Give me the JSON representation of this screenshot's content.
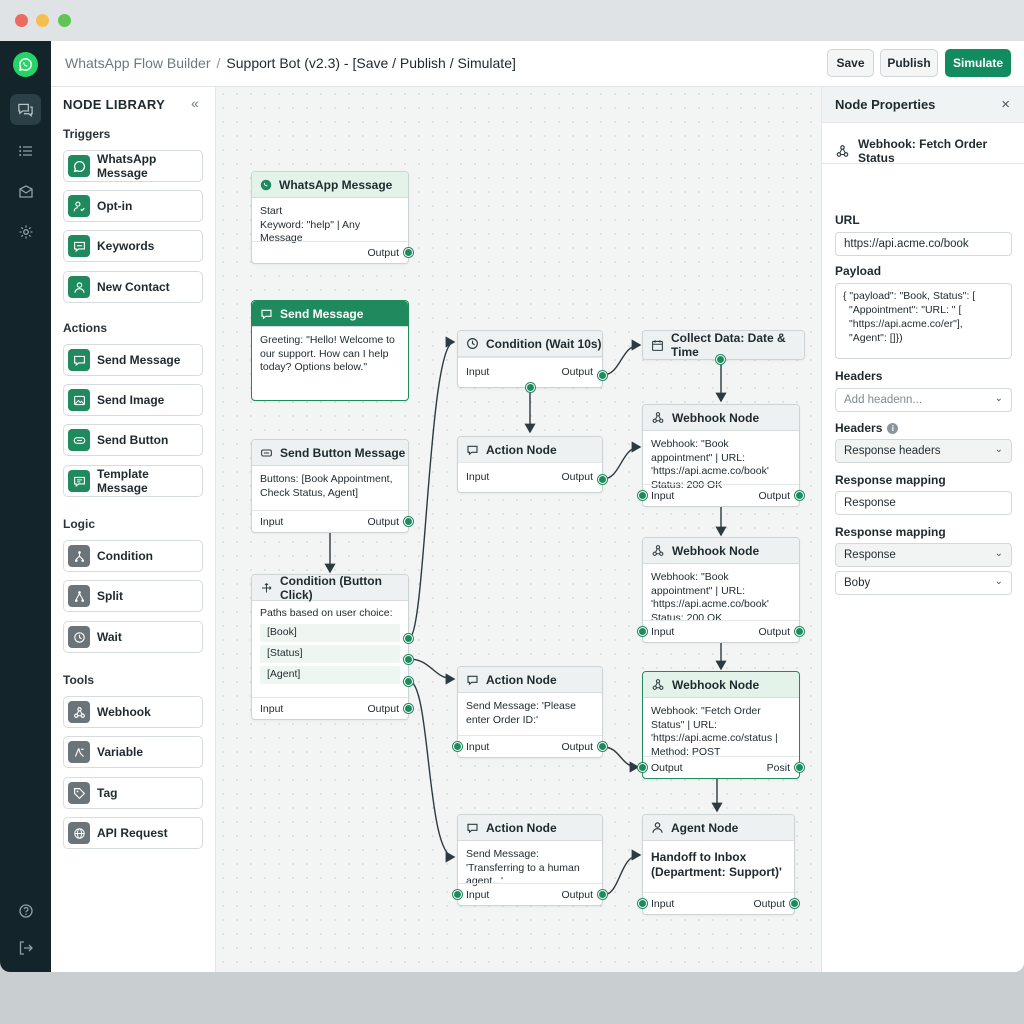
{
  "window": {
    "traffic_lights": [
      "#ec6a5e",
      "#f4bf4f",
      "#61c554"
    ]
  },
  "colors": {
    "accent": "#128c5e",
    "rail": "#13252b",
    "whatsapp": "#25d366"
  },
  "rail": {
    "items": [
      {
        "name": "chat-icon",
        "active": true
      },
      {
        "name": "list-icon",
        "active": false
      },
      {
        "name": "inbox-icon",
        "active": false
      },
      {
        "name": "gear-icon",
        "active": false
      },
      {
        "name": "help-icon",
        "active": false
      },
      {
        "name": "logout-icon",
        "active": false
      }
    ]
  },
  "header": {
    "app": "WhatsApp Flow Builder",
    "separator": "/",
    "flow": "Support Bot (v2.3) - [Save / Publish / Simulate]",
    "save_label": "Save",
    "publish_label": "Publish",
    "simulate_label": "Simulate"
  },
  "library": {
    "title": "NODE LIBRARY",
    "collapse": "«",
    "sections": {
      "triggers": "Triggers",
      "actions": "Actions",
      "logic": "Logic",
      "tools": "Tools"
    },
    "items": {
      "whatsapp_message": "WhatsApp Message",
      "opt_in": "Opt-in",
      "keywords": "Keywords",
      "new_contact": "New Contact",
      "send_message": "Send Message",
      "send_image": "Send Image",
      "send_button": "Send Button",
      "template_message": "Template Message",
      "condition": "Condition",
      "split": "Split",
      "wait": "Wait",
      "webhook": "Webhook",
      "variable": "Variable",
      "tag": "Tag",
      "api_request": "API Request"
    }
  },
  "nodes": {
    "n1": {
      "title": "WhatsApp Message",
      "line1": "Start",
      "line2": "Keyword: \"help\" | Any Message",
      "out": "Output"
    },
    "n2": {
      "title": "Send Message",
      "body": "Greeting: \"Hello! Welcome to our support. How can I help today? Options below.\""
    },
    "n3": {
      "title": "Send Button Message",
      "body": "Buttons: [Book Appointment, Check Status, Agent]",
      "in": "Input",
      "out": "Output"
    },
    "n4": {
      "title": "Condition (Button Click)",
      "intro": "Paths based on user choice:",
      "r1": "[Book]",
      "r2": "[Status]",
      "r3": "[Agent]",
      "in": "Input",
      "out": "Output"
    },
    "n5": {
      "title": "Condition (Wait 10s)",
      "in": "Input",
      "out": "Output"
    },
    "n6": {
      "title": "Action Node",
      "in": "Input",
      "out": "Output"
    },
    "n7": {
      "title": "Action Node",
      "body": "Send Message: 'Please enter Order ID:'",
      "in": "Input",
      "out": "Output"
    },
    "n8": {
      "title": "Action Node",
      "body": "Send Message: 'Transferring to a human agent...'",
      "in": "Input",
      "out": "Output"
    },
    "n9": {
      "title": "Collect Data: Date & Time"
    },
    "n10": {
      "title": "Webhook Node",
      "body": "Webhook: \"Book appointment\" | URL: 'https://api.acme.co/book' Status: 200 OK",
      "in": "Input",
      "out": "Output"
    },
    "n11": {
      "title": "Webhook Node",
      "body": "Webhook: \"Book appointment\" | URL: 'https://api.acme.co/book' Status: 200 OK",
      "in": "Input",
      "out": "Output"
    },
    "n12": {
      "title": "Webhook Node",
      "body": "Webhook: \"Fetch Order Status\" | URL: 'https://api.acme.co/status | Method: POST",
      "in": "Output",
      "out": "Posit"
    },
    "n13": {
      "title": "Agent Node",
      "body": "Handoff to Inbox (Department: Support)'",
      "in": "Input",
      "out": "Output"
    }
  },
  "properties": {
    "title": "Node Properties",
    "close": "×",
    "node_name": "Webhook: Fetch Order Status",
    "url_label": "URL",
    "url_value": "https://api.acme.co/book",
    "payload_label": "Payload",
    "payload_l1": "{ \"payload\": \"Book, Status\": [",
    "payload_l2": "\"Appointment\": \"URL: \" [",
    "payload_l3": "\"https://api.acme.co/er\"],",
    "payload_l4": "\"Agent\": []})",
    "headers_label": "Headers",
    "headers_placeholder": "Add headenn...",
    "headers2_label": "Headers",
    "headers2_value": "Response headers",
    "mapping_label": "Response mapping",
    "mapping_value": "Response",
    "mapping2_label": "Response mapping",
    "mapping2_value": "Response",
    "body_value": "Boby"
  }
}
